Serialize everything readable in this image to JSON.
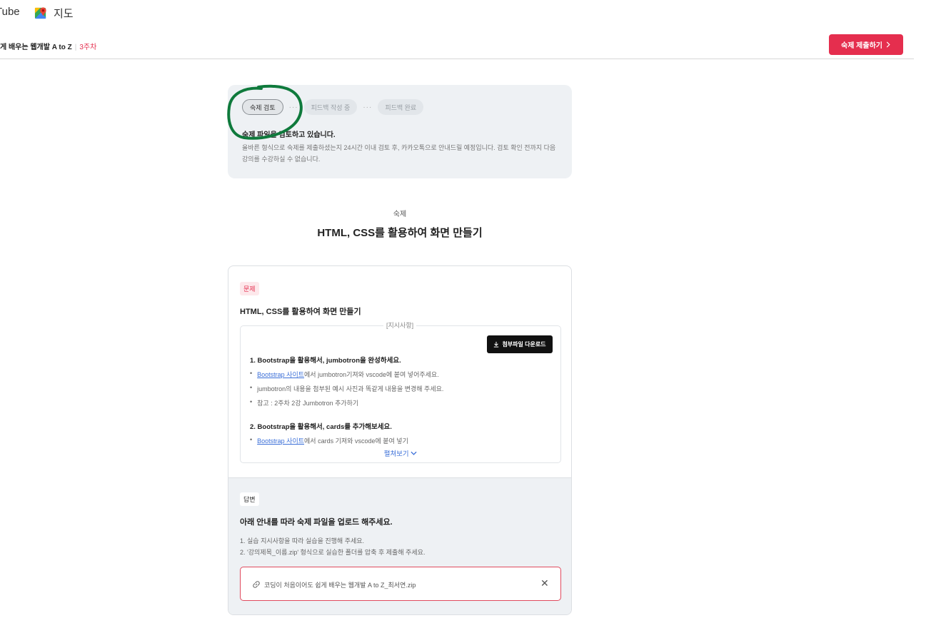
{
  "bookmarks": {
    "youtube_label": "Tube",
    "maps_label": "지도"
  },
  "header": {
    "course_title": "게 배우는 웹개발 A to Z",
    "separator": "|",
    "week": "3주차",
    "submit_label": "숙제 제출하기",
    "submit_icon": "chevron-right-icon"
  },
  "status": {
    "steps": [
      {
        "label": "숙제 검토",
        "active": true
      },
      {
        "label": "피드백 작성 중",
        "active": false
      },
      {
        "label": "피드백 완료",
        "active": false
      }
    ],
    "step_separator": "···",
    "title": "숙제 파일을 검토하고 있습니다.",
    "description": "올바른 형식으로 숙제를 제출하셨는지 24시간 이내 검토 후, 카카오톡으로 안내드릴 예정입니다. 검토 확인 전까지 다음 강의를 수강하실 수 없습니다.",
    "annotation_color": "#0f7a3c"
  },
  "homework": {
    "label": "숙제",
    "title": "HTML, CSS를 활용하여 화면 만들기"
  },
  "problem": {
    "badge": "문제",
    "title": "HTML, CSS를 활용하여 화면 만들기",
    "instructions_label": "[지시사항]",
    "download_label": "첨부파일 다운로드",
    "download_icon": "download-icon",
    "section1": {
      "heading": "1. Bootstrap을 활용해서, jumbotron을 완성하세요.",
      "items": [
        {
          "link": "Bootstrap 사이트",
          "text": "에서 jumbotron기져와 vscode에 붙여 넣어주세요."
        },
        {
          "link": "",
          "text": "jumbotron의 내용을 첨부된 예시 사진과 똑같게 내용을 변경해 주세요."
        },
        {
          "link": "",
          "text": "참고 : 2주차 2강 Jumbotron 추가하기"
        }
      ]
    },
    "section2": {
      "heading": "2. Bootstrap을 활용해서, cards를 추가해보세요.",
      "items": [
        {
          "link": "Bootstrap 사이트",
          "text": "에서 cards 기져와 vscode에 붙여 넣기"
        }
      ]
    },
    "expand_label": "펼쳐보기"
  },
  "answer": {
    "badge": "답변",
    "title": "아래 안내를 따라 숙제 파일을 업로드 해주세요.",
    "step1": "1. 실습 지시사항을 따라 실습을 진행해 주세요.",
    "step2": "2. '강의제목_이름.zip' 형식으로 실습한 폴더를 압축 후 제출해 주세요.",
    "file_name": "코딩이 처음이어도 쉽게 배우는 웹개발 A to Z_최서연.zip",
    "close_symbol": "✕"
  },
  "colors": {
    "accent": "#e52e4e",
    "link": "#3b6fd8",
    "panel_bg": "#eef1f4"
  }
}
